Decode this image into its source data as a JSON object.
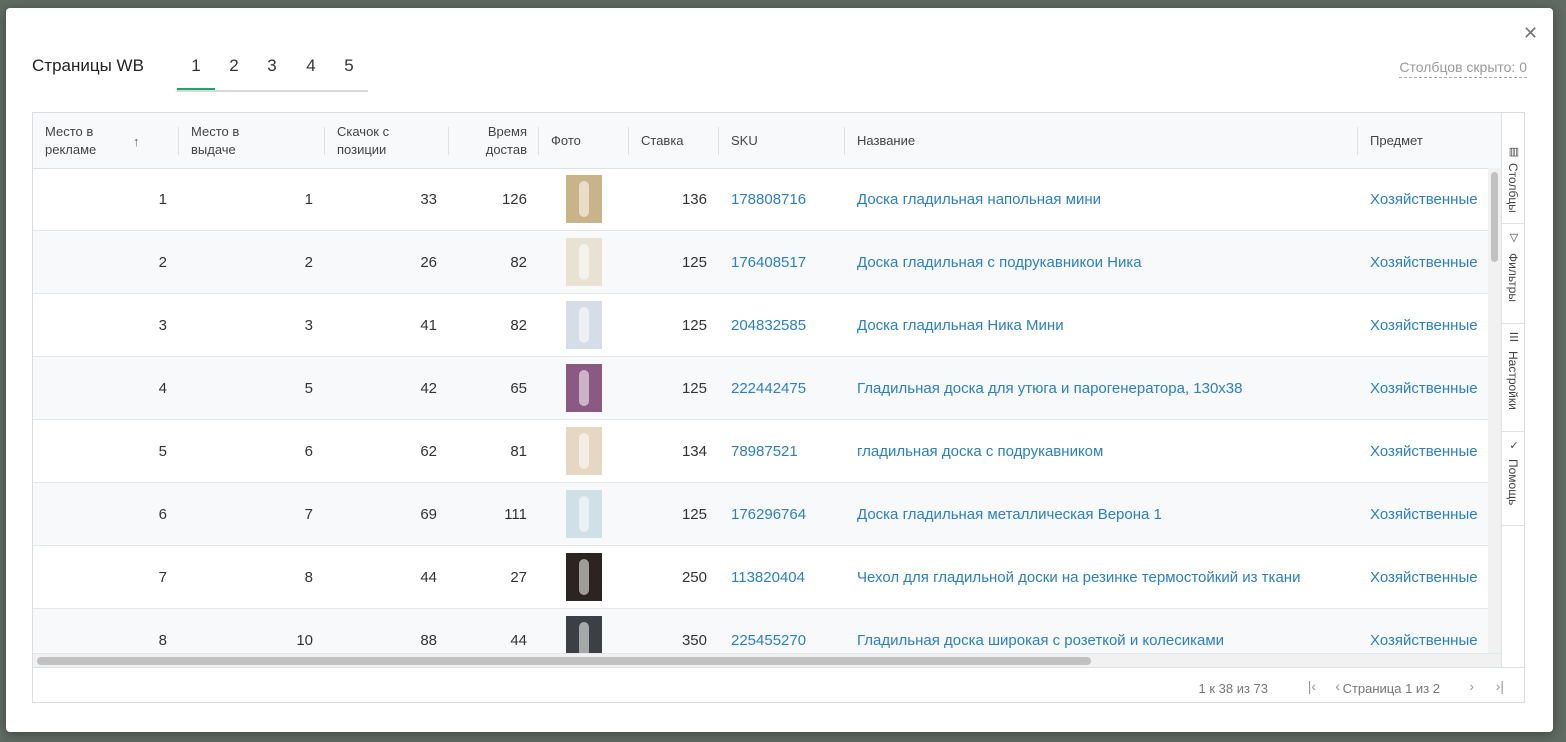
{
  "header": {
    "title": "Страницы WB",
    "tabs": [
      "1",
      "2",
      "3",
      "4",
      "5"
    ],
    "hidden_columns": "Столбцов скрыто: 0",
    "close_icon": "close-icon"
  },
  "columns": [
    {
      "label": "Место в рекламе"
    },
    {
      "label": "Место в выдаче"
    },
    {
      "label": "Скачок с позиции"
    },
    {
      "label": "Время достав"
    },
    {
      "label": "Фото"
    },
    {
      "label": "Ставка"
    },
    {
      "label": "SKU"
    },
    {
      "label": "Название"
    },
    {
      "label": "Предмет"
    }
  ],
  "rows": [
    {
      "ad_place": "1",
      "search_place": "1",
      "jump": "33",
      "delivery": "126",
      "bid": "136",
      "sku": "178808716",
      "name": "Доска гладильная напольная мини",
      "subject": "Хозяйственные",
      "thumb_color": "#c9b48a"
    },
    {
      "ad_place": "2",
      "search_place": "2",
      "jump": "26",
      "delivery": "82",
      "bid": "125",
      "sku": "176408517",
      "name": "Доска гладильная с подрукавникои Ника",
      "subject": "Хозяйственные",
      "thumb_color": "#e8e2d2"
    },
    {
      "ad_place": "3",
      "search_place": "3",
      "jump": "41",
      "delivery": "82",
      "bid": "125",
      "sku": "204832585",
      "name": "Доска гладильная Ника Мини",
      "subject": "Хозяйственные",
      "thumb_color": "#d7dde6"
    },
    {
      "ad_place": "4",
      "search_place": "5",
      "jump": "42",
      "delivery": "65",
      "bid": "125",
      "sku": "222442475",
      "name": "Гладильная доска для утюга и парогенератора, 130х38",
      "subject": "Хозяйственные",
      "thumb_color": "#8a5a82"
    },
    {
      "ad_place": "5",
      "search_place": "6",
      "jump": "62",
      "delivery": "81",
      "bid": "134",
      "sku": "78987521",
      "name": "гладильная доска с подрукавником",
      "subject": "Хозяйственные",
      "thumb_color": "#e6d7c2"
    },
    {
      "ad_place": "6",
      "search_place": "7",
      "jump": "69",
      "delivery": "111",
      "bid": "125",
      "sku": "176296764",
      "name": "Доска гладильная металлическая Верона 1",
      "subject": "Хозяйственные",
      "thumb_color": "#cfe0e6"
    },
    {
      "ad_place": "7",
      "search_place": "8",
      "jump": "44",
      "delivery": "27",
      "bid": "250",
      "sku": "113820404",
      "name": "Чехол для гладильной доски на резинке термостойкий из ткани",
      "subject": "Хозяйственные",
      "thumb_color": "#2b2420"
    },
    {
      "ad_place": "8",
      "search_place": "10",
      "jump": "88",
      "delivery": "44",
      "bid": "350",
      "sku": "225455270",
      "name": "Гладильная доска широкая с розеткой и колесиками",
      "subject": "Хозяйственные",
      "thumb_color": "#3c3f44"
    }
  ],
  "side_panel": [
    {
      "label": "Столбцы",
      "icon": "columns-icon"
    },
    {
      "label": "Фильтры",
      "icon": "filter-icon"
    },
    {
      "label": "Настройки",
      "icon": "settings-icon"
    },
    {
      "label": "Помощь",
      "icon": "check-icon"
    }
  ],
  "footer": {
    "range": "1 к 38 из 73",
    "page": "Страница 1 из 2"
  },
  "colors": {
    "accent": "#21a366",
    "link": "#2a7fc9"
  }
}
